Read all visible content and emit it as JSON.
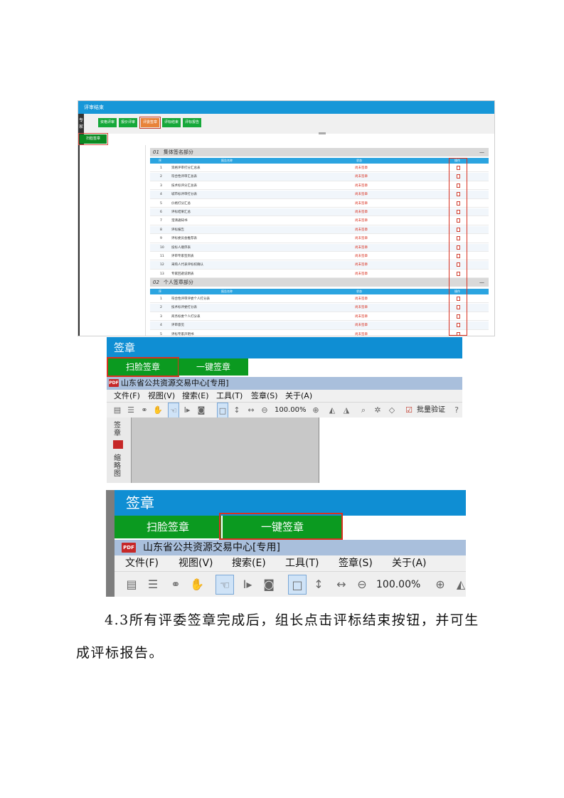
{
  "screenshot1": {
    "header_title": "评审结束",
    "side_tab": "专家",
    "tabs": [
      "资格评审",
      "报价评审",
      "评委签章",
      "评标结束",
      "评标报告"
    ],
    "active_tab_index": 2,
    "scan_button": "扫脸签章",
    "section1": {
      "num": "01",
      "title": "集体签名部分",
      "minimize": "—"
    },
    "section2": {
      "num": "02",
      "title": "个人签章部分",
      "minimize": "—"
    },
    "columns": {
      "no": "序",
      "name": "报告名称",
      "status": "状态",
      "op": "操作"
    },
    "rows1": [
      {
        "no": "1",
        "name": "资格评审打分汇总表",
        "status": "尚未签章"
      },
      {
        "no": "2",
        "name": "符合性评审汇总表",
        "status": "尚未签章"
      },
      {
        "no": "3",
        "name": "技术标评分汇总表",
        "status": "尚未签章"
      },
      {
        "no": "4",
        "name": "城市标评审打分表",
        "status": "尚未签章"
      },
      {
        "no": "5",
        "name": "价格打分汇总",
        "status": "尚未签章"
      },
      {
        "no": "6",
        "name": "评标结果汇总",
        "status": "尚未签章"
      },
      {
        "no": "7",
        "name": "澄清通知书",
        "status": "尚未签章"
      },
      {
        "no": "8",
        "name": "评标报告",
        "status": "尚未签章"
      },
      {
        "no": "9",
        "name": "评标委员会推荐表",
        "status": "尚未签章"
      },
      {
        "no": "10",
        "name": "投标人顺序表",
        "status": "尚未签章"
      },
      {
        "no": "11",
        "name": "评审专家签到表",
        "status": "尚未签章"
      },
      {
        "no": "12",
        "name": "采购人代表评标权确认",
        "status": "尚未签章"
      },
      {
        "no": "13",
        "name": "专家回避说明表",
        "status": "尚未签章"
      }
    ],
    "rows2": [
      {
        "no": "1",
        "name": "符合性评审评委个人打分表",
        "status": "尚未签章"
      },
      {
        "no": "2",
        "name": "技术标评委打分表",
        "status": "尚未签章"
      },
      {
        "no": "3",
        "name": "商务标委个人打分表",
        "status": "尚未签章"
      },
      {
        "no": "4",
        "name": "评审意见",
        "status": "尚未签章"
      },
      {
        "no": "5",
        "name": "评标专家声明书",
        "status": "尚未签章"
      }
    ]
  },
  "screenshot2": {
    "title": "签章",
    "btn_scan": "扫脸签章",
    "btn_one": "一键签章",
    "badge": "PDF",
    "window_title": "山东省公共资源交易中心[专用]",
    "menus": [
      "文件(F)",
      "视图(V)",
      "搜索(E)",
      "工具(T)",
      "签章(S)",
      "关于(A)"
    ],
    "zoom": "100.00%",
    "batch_verify": "批量验证",
    "side_text1": "签章",
    "side_text2": "缩略图"
  },
  "screenshot3": {
    "title": "签章",
    "btn_scan": "扫脸签章",
    "btn_one": "一键签章",
    "badge": "PDF",
    "window_title": "山东省公共资源交易中心[专用]",
    "menus": [
      "文件(F)",
      "视图(V)",
      "搜索(E)",
      "工具(T)",
      "签章(S)",
      "关于(A)"
    ],
    "zoom": "100.00%"
  },
  "paragraph": {
    "line1": "4.3所有评委签章完成后，组长点击评标结束按钮，并可生",
    "line2": "成评标报告。"
  }
}
